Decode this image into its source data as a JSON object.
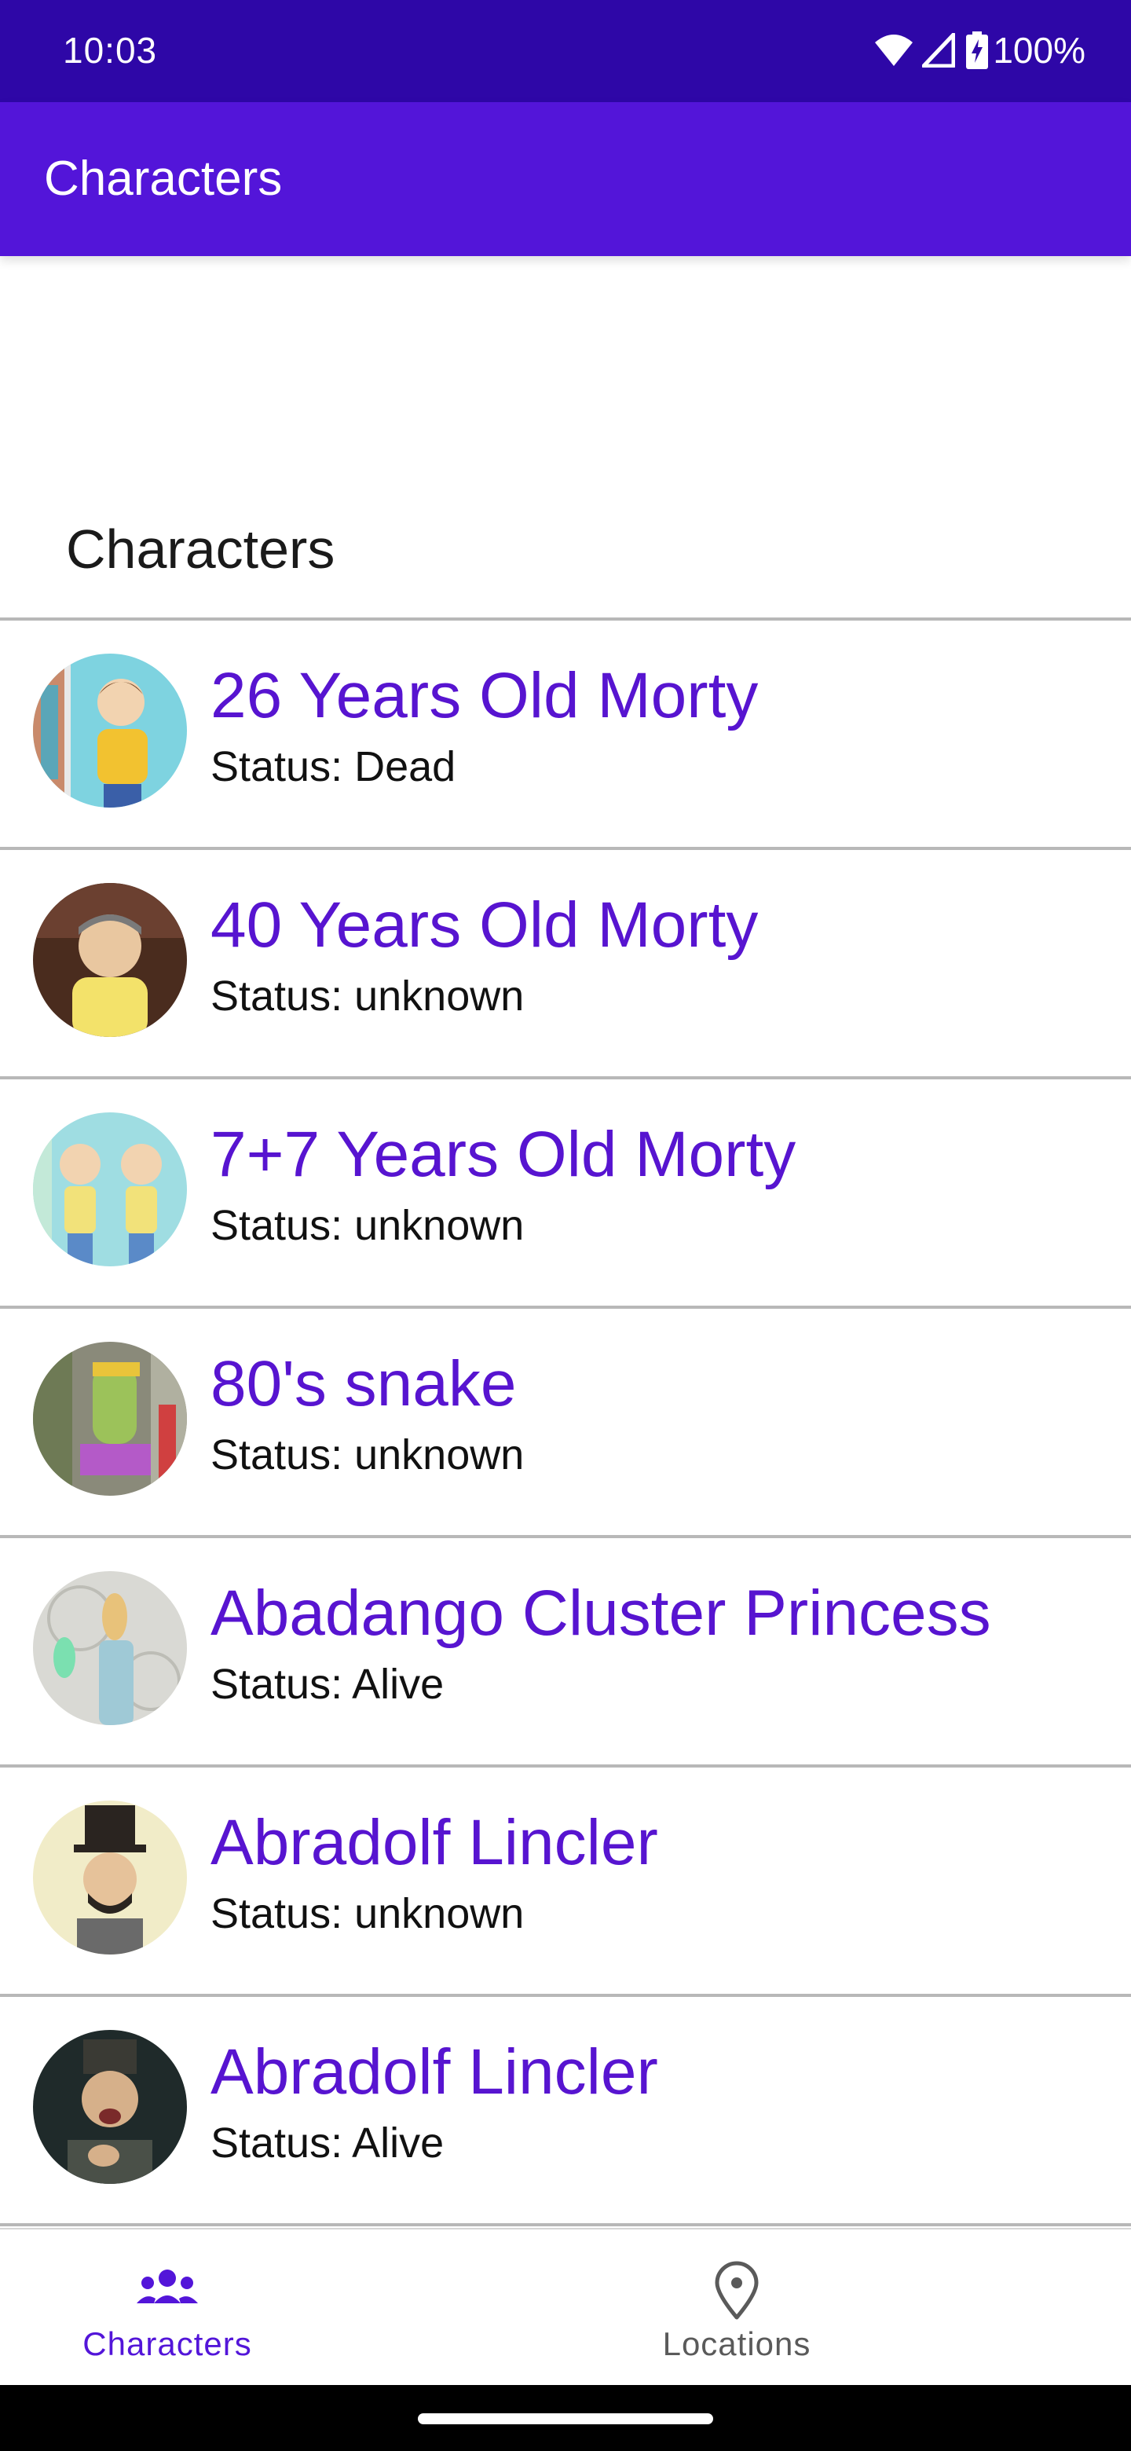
{
  "status_bar": {
    "time": "10:03",
    "battery": "100%",
    "icons": [
      "wifi-icon",
      "cell-signal-icon",
      "battery-charging-icon"
    ]
  },
  "app_bar": {
    "title": "Characters"
  },
  "section": {
    "title": "Characters"
  },
  "characters": [
    {
      "name": "26 Years Old Morty",
      "status": "Status: Dead"
    },
    {
      "name": "40 Years Old Morty",
      "status": "Status: unknown"
    },
    {
      "name": "7+7 Years Old Morty",
      "status": "Status: unknown"
    },
    {
      "name": "80's snake",
      "status": "Status: unknown"
    },
    {
      "name": "Abadango Cluster Princess",
      "status": "Status: Alive"
    },
    {
      "name": "Abradolf Lincler",
      "status": "Status: unknown"
    },
    {
      "name": "Abradolf Lincler",
      "status": "Status: Alive"
    }
  ],
  "bottom_nav": {
    "items": [
      {
        "label": "Characters",
        "icon": "people-icon",
        "selected": true
      },
      {
        "label": "Locations",
        "icon": "location-pin-icon",
        "selected": false
      }
    ]
  },
  "colors": {
    "status_bar": "#2e07a7",
    "app_bar": "#5315d9",
    "accent": "#5714d0",
    "nav_active": "#5315d9",
    "nav_inactive": "#5a5a5a"
  }
}
